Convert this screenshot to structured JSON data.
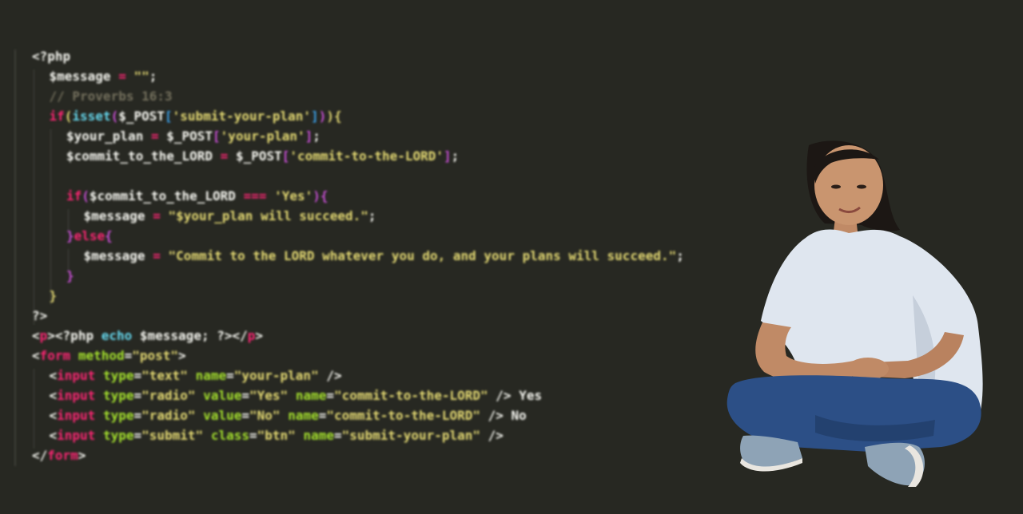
{
  "code_lines": [
    [
      [
        "<?php",
        "default"
      ]
    ],
    [
      [
        "$message",
        "default"
      ],
      [
        " = ",
        "pink"
      ],
      [
        "\"\"",
        "yellow"
      ],
      [
        ";",
        "default"
      ]
    ],
    [
      [
        "// Proverbs 16:3",
        "comment"
      ]
    ],
    [
      [
        "if",
        "pink"
      ],
      [
        "(",
        "bracket-y"
      ],
      [
        "isset",
        "cyan"
      ],
      [
        "(",
        "bracket-p"
      ],
      [
        "$_POST",
        "default"
      ],
      [
        "[",
        "bracket-b"
      ],
      [
        "'submit-your-plan'",
        "yellow"
      ],
      [
        "]",
        "bracket-b"
      ],
      [
        ")",
        "bracket-p"
      ],
      [
        ")",
        "bracket-y"
      ],
      [
        "{",
        "bracket-y"
      ]
    ],
    [
      [
        "$your_plan",
        "default"
      ],
      [
        " = ",
        "pink"
      ],
      [
        "$_POST",
        "default"
      ],
      [
        "[",
        "bracket-p"
      ],
      [
        "'your-plan'",
        "yellow"
      ],
      [
        "]",
        "bracket-p"
      ],
      [
        ";",
        "default"
      ]
    ],
    [
      [
        "$commit_to_the_LORD",
        "default"
      ],
      [
        " = ",
        "pink"
      ],
      [
        "$_POST",
        "default"
      ],
      [
        "[",
        "bracket-p"
      ],
      [
        "'commit-to-the-LORD'",
        "yellow"
      ],
      [
        "]",
        "bracket-p"
      ],
      [
        ";",
        "default"
      ]
    ],
    [],
    [
      [
        "if",
        "pink"
      ],
      [
        "(",
        "bracket-p"
      ],
      [
        "$commit_to_the_LORD",
        "default"
      ],
      [
        " === ",
        "pink"
      ],
      [
        "'Yes'",
        "yellow"
      ],
      [
        ")",
        "bracket-p"
      ],
      [
        "{",
        "bracket-p"
      ]
    ],
    [
      [
        "$message",
        "default"
      ],
      [
        " = ",
        "pink"
      ],
      [
        "\"$your_plan will succeed.\"",
        "yellow"
      ],
      [
        ";",
        "default"
      ]
    ],
    [
      [
        "}",
        "bracket-p"
      ],
      [
        "else",
        "pink"
      ],
      [
        "{",
        "bracket-p"
      ]
    ],
    [
      [
        "$message",
        "default"
      ],
      [
        " = ",
        "pink"
      ],
      [
        "\"Commit to the LORD whatever you do, and your plans will succeed.\"",
        "yellow"
      ],
      [
        ";",
        "default"
      ]
    ],
    [
      [
        "}",
        "bracket-p"
      ]
    ],
    [
      [
        "}",
        "bracket-y"
      ]
    ],
    [
      [
        "?>",
        "default"
      ]
    ],
    [
      [
        "<",
        "default"
      ],
      [
        "p",
        "pink"
      ],
      [
        "><?php ",
        "default"
      ],
      [
        "echo",
        "cyan"
      ],
      [
        " $message; ?></",
        "default"
      ],
      [
        "p",
        "pink"
      ],
      [
        ">",
        "default"
      ]
    ],
    [
      [
        "<",
        "default"
      ],
      [
        "form",
        "pink"
      ],
      [
        " ",
        "default"
      ],
      [
        "method",
        "green"
      ],
      [
        "=",
        "default"
      ],
      [
        "\"post\"",
        "yellow"
      ],
      [
        ">",
        "default"
      ]
    ],
    [
      [
        "<",
        "default"
      ],
      [
        "input",
        "pink"
      ],
      [
        " ",
        "default"
      ],
      [
        "type",
        "green"
      ],
      [
        "=",
        "default"
      ],
      [
        "\"text\"",
        "yellow"
      ],
      [
        " ",
        "default"
      ],
      [
        "name",
        "green"
      ],
      [
        "=",
        "default"
      ],
      [
        "\"your-plan\"",
        "yellow"
      ],
      [
        " />",
        "default"
      ]
    ],
    [
      [
        "<",
        "default"
      ],
      [
        "input",
        "pink"
      ],
      [
        " ",
        "default"
      ],
      [
        "type",
        "green"
      ],
      [
        "=",
        "default"
      ],
      [
        "\"radio\"",
        "yellow"
      ],
      [
        " ",
        "default"
      ],
      [
        "value",
        "green"
      ],
      [
        "=",
        "default"
      ],
      [
        "\"Yes\"",
        "yellow"
      ],
      [
        " ",
        "default"
      ],
      [
        "name",
        "green"
      ],
      [
        "=",
        "default"
      ],
      [
        "\"commit-to-the-LORD\"",
        "yellow"
      ],
      [
        " /> Yes",
        "default"
      ]
    ],
    [
      [
        "<",
        "default"
      ],
      [
        "input",
        "pink"
      ],
      [
        " ",
        "default"
      ],
      [
        "type",
        "green"
      ],
      [
        "=",
        "default"
      ],
      [
        "\"radio\"",
        "yellow"
      ],
      [
        " ",
        "default"
      ],
      [
        "value",
        "green"
      ],
      [
        "=",
        "default"
      ],
      [
        "\"No\"",
        "yellow"
      ],
      [
        " ",
        "default"
      ],
      [
        "name",
        "green"
      ],
      [
        "=",
        "default"
      ],
      [
        "\"commit-to-the-LORD\"",
        "yellow"
      ],
      [
        " /> No",
        "default"
      ]
    ],
    [
      [
        "<",
        "default"
      ],
      [
        "input",
        "pink"
      ],
      [
        " ",
        "default"
      ],
      [
        "type",
        "green"
      ],
      [
        "=",
        "default"
      ],
      [
        "\"submit\"",
        "yellow"
      ],
      [
        " ",
        "default"
      ],
      [
        "class",
        "green"
      ],
      [
        "=",
        "default"
      ],
      [
        "\"btn\"",
        "yellow"
      ],
      [
        " ",
        "default"
      ],
      [
        "name",
        "green"
      ],
      [
        "=",
        "default"
      ],
      [
        "\"submit-your-plan\"",
        "yellow"
      ],
      [
        " />",
        "default"
      ]
    ],
    [
      [
        "</",
        "default"
      ],
      [
        "form",
        "pink"
      ],
      [
        ">",
        "default"
      ]
    ]
  ],
  "colors": {
    "background": "#272822",
    "pink": "#f92672",
    "yellow": "#e6db74",
    "cyan": "#66d9ef",
    "green": "#a6e22e",
    "comment": "#75715e"
  },
  "photo": {
    "subject": "person-sitting-cross-legged",
    "shirt_color": "#dfe6ef",
    "jeans_color": "#2c4f86"
  }
}
